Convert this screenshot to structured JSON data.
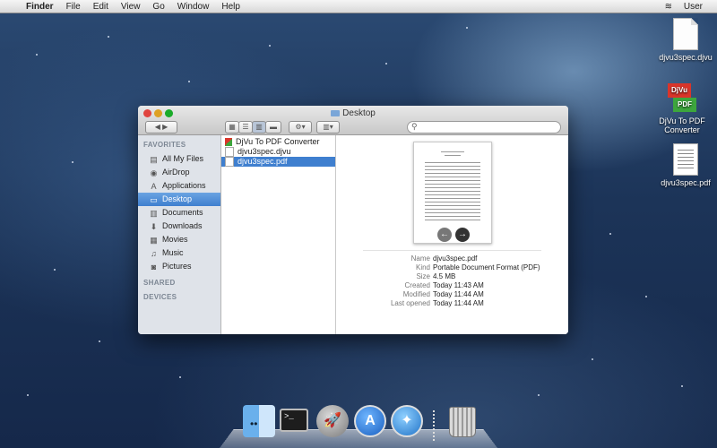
{
  "menubar": {
    "app_name": "Finder",
    "items": [
      "File",
      "Edit",
      "View",
      "Go",
      "Window",
      "Help"
    ],
    "user": "User"
  },
  "desktop_icons": [
    {
      "label": "djvu3spec.djvu",
      "icon": "djvu-document-icon"
    },
    {
      "label": "DjVu To PDF Converter",
      "icon": "app-icon",
      "app_top": "DjVu",
      "app_bottom": "PDF"
    },
    {
      "label": "djvu3spec.pdf",
      "icon": "pdf-document-icon"
    }
  ],
  "finder": {
    "title": "Desktop",
    "search_placeholder": "",
    "sidebar": {
      "favorites_header": "FAVORITES",
      "favorites": [
        {
          "label": "All My Files",
          "icon": "all-files-icon"
        },
        {
          "label": "AirDrop",
          "icon": "airdrop-icon"
        },
        {
          "label": "Applications",
          "icon": "applications-icon"
        },
        {
          "label": "Desktop",
          "icon": "desktop-icon",
          "selected": true
        },
        {
          "label": "Documents",
          "icon": "documents-icon"
        },
        {
          "label": "Downloads",
          "icon": "downloads-icon"
        },
        {
          "label": "Movies",
          "icon": "movies-icon"
        },
        {
          "label": "Music",
          "icon": "music-icon"
        },
        {
          "label": "Pictures",
          "icon": "pictures-icon"
        }
      ],
      "shared_header": "SHARED",
      "devices_header": "DEVICES"
    },
    "files": [
      {
        "name": "DjVu To PDF Converter",
        "type": "app"
      },
      {
        "name": "djvu3spec.djvu",
        "type": "doc"
      },
      {
        "name": "djvu3spec.pdf",
        "type": "doc",
        "selected": true
      }
    ],
    "preview": {
      "info": [
        {
          "key": "Name",
          "value": "djvu3spec.pdf"
        },
        {
          "key": "Kind",
          "value": "Portable Document Format (PDF)"
        },
        {
          "key": "Size",
          "value": "4.5 MB"
        },
        {
          "key": "Created",
          "value": "Today 11:43 AM"
        },
        {
          "key": "Modified",
          "value": "Today 11:44 AM"
        },
        {
          "key": "Last opened",
          "value": "Today 11:44 AM"
        }
      ]
    }
  },
  "dock": {
    "items": [
      "finder-icon",
      "terminal-icon",
      "launchpad-icon",
      "app-store-icon",
      "safari-icon",
      "trash-icon"
    ]
  }
}
